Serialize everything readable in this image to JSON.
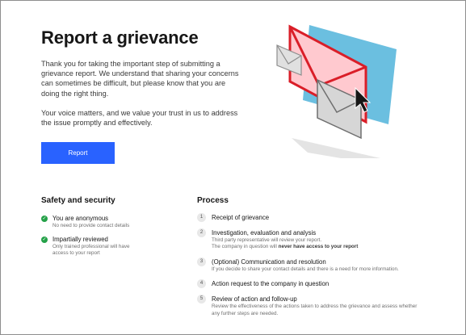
{
  "page": {
    "title": "Report a grievance",
    "intro_p1": "Thank you for taking the important step of submitting a grievance report. We understand that sharing your concerns can sometimes be difficult, but please know that you are doing the right thing.",
    "intro_p2": "Your voice matters, and we value your trust in us to address the issue promptly and effectively.",
    "report_button": "Report"
  },
  "safety": {
    "title": "Safety and security",
    "items": [
      {
        "label": "You are anonymous",
        "sub": "No need to provide contact details"
      },
      {
        "label": "Impartially reviewed",
        "sub": "Only trained professional will have access to your report"
      }
    ]
  },
  "process": {
    "title": "Process",
    "steps": [
      {
        "num": "1",
        "label": "Receipt of grievance"
      },
      {
        "num": "2",
        "label": "Investigation, evaluation and analysis",
        "sub1": "Third party representative will review your report.",
        "sub2_prefix": "The company in question will ",
        "sub2_bold": "never have access to your report"
      },
      {
        "num": "3",
        "label": "(Optional) Communication and resolution",
        "sub": "If you decide to share your contact details and there is a need for more information."
      },
      {
        "num": "4",
        "label": "Action request to the company in question"
      },
      {
        "num": "5",
        "label": "Review of action and follow-up",
        "sub": "Review the effectiveness of the actions taken to address the grievance and assess whether any further steps are needed."
      }
    ]
  },
  "colors": {
    "primary": "#2962ff",
    "success": "#24a148",
    "envelope_red": "#da1e28",
    "envelope_pink": "#ffc9cf",
    "panel_blue": "#6bbfe0"
  },
  "icons": {
    "check": "checkmark-filled-icon",
    "illustration": "envelopes-illustration",
    "cursor": "pointer-cursor-icon"
  }
}
